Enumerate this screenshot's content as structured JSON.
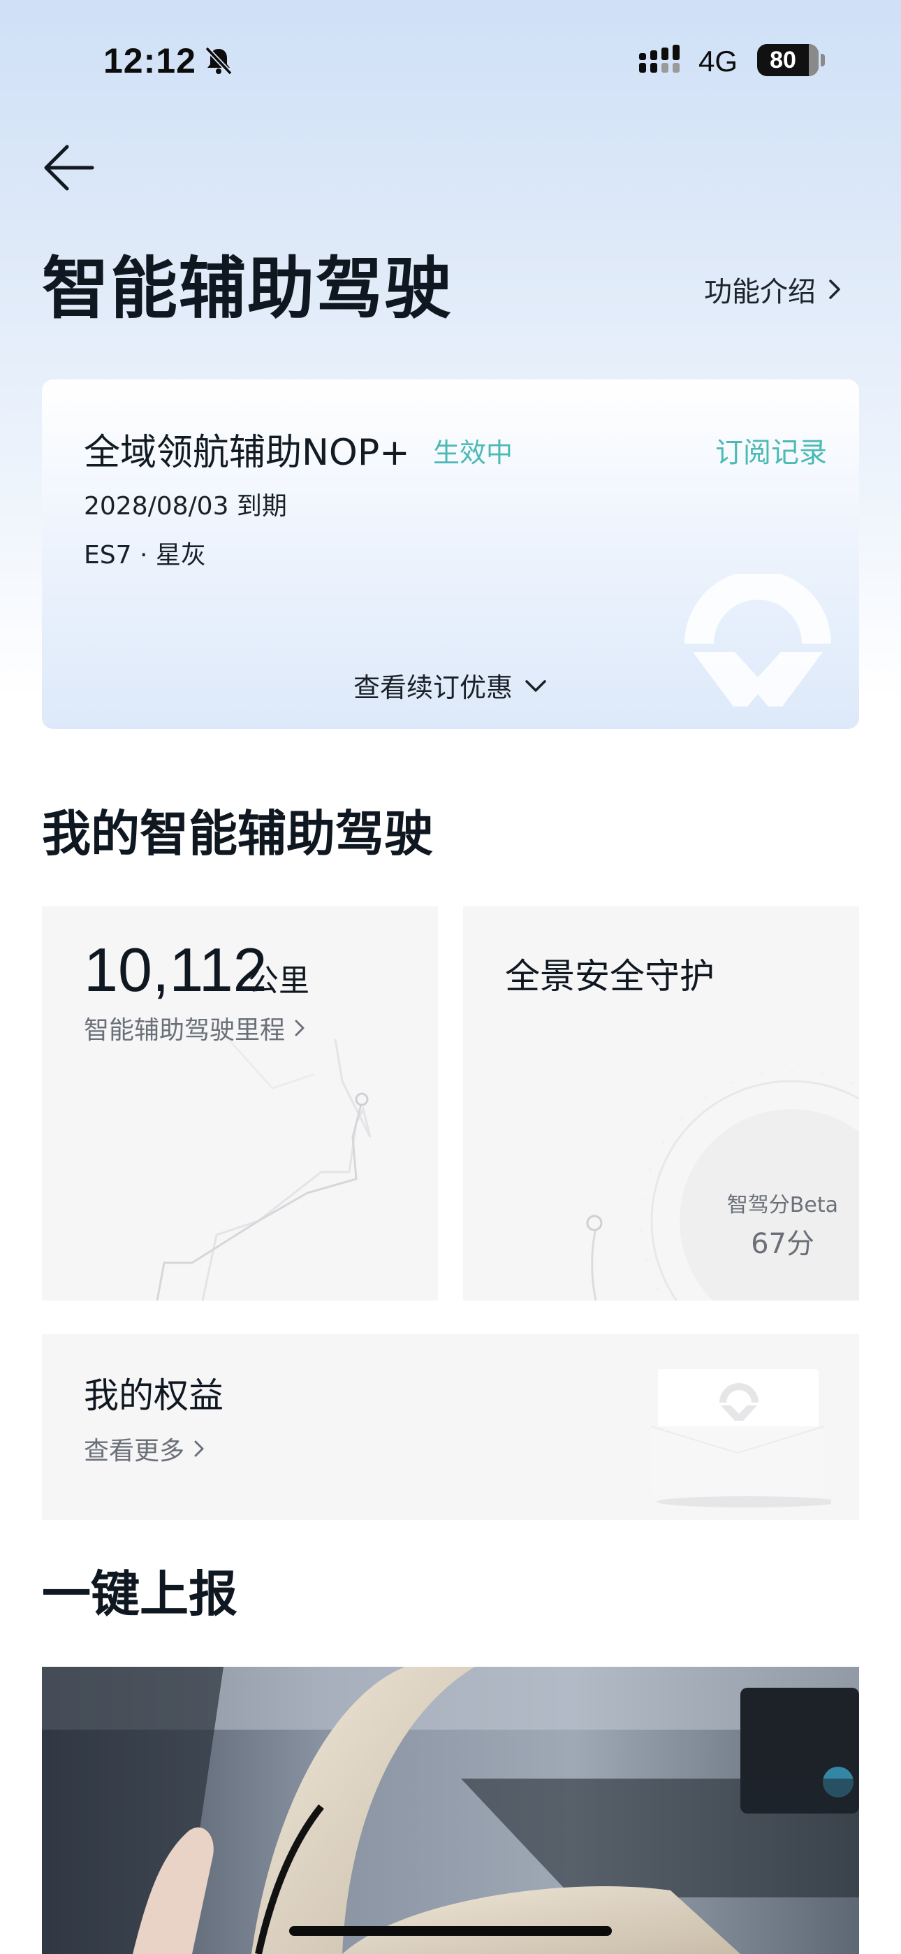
{
  "status_bar": {
    "time": "12:12",
    "network": "4G",
    "battery": "80",
    "icons": [
      "bell-muted-icon",
      "signal-icon",
      "battery-icon"
    ]
  },
  "header": {
    "back_icon": "arrow-left-icon",
    "title": "智能辅助驾驶",
    "feature_intro": "功能介绍"
  },
  "subscription": {
    "name": "全域领航辅助NOP+",
    "status": "生效中",
    "records_link": "订阅记录",
    "expiry": "2028/08/03 到期",
    "vehicle": "ES7 · 星灰",
    "renew_offer": "查看续订优惠"
  },
  "my_section": {
    "title": "我的智能辅助驾驶",
    "mileage": {
      "value": "10,112",
      "unit": "公里",
      "link": "智能辅助驾驶里程"
    },
    "safety": {
      "title": "全景安全守护",
      "score_label": "智驾分Beta",
      "score_value": "67分"
    },
    "rights": {
      "title": "我的权益",
      "link": "查看更多"
    }
  },
  "report_section": {
    "title": "一键上报"
  },
  "colors": {
    "accent": "#4bbab4",
    "title_text": "#0f1720",
    "secondary_text": "#6b7078",
    "tile_background": "#f6f6f7"
  }
}
